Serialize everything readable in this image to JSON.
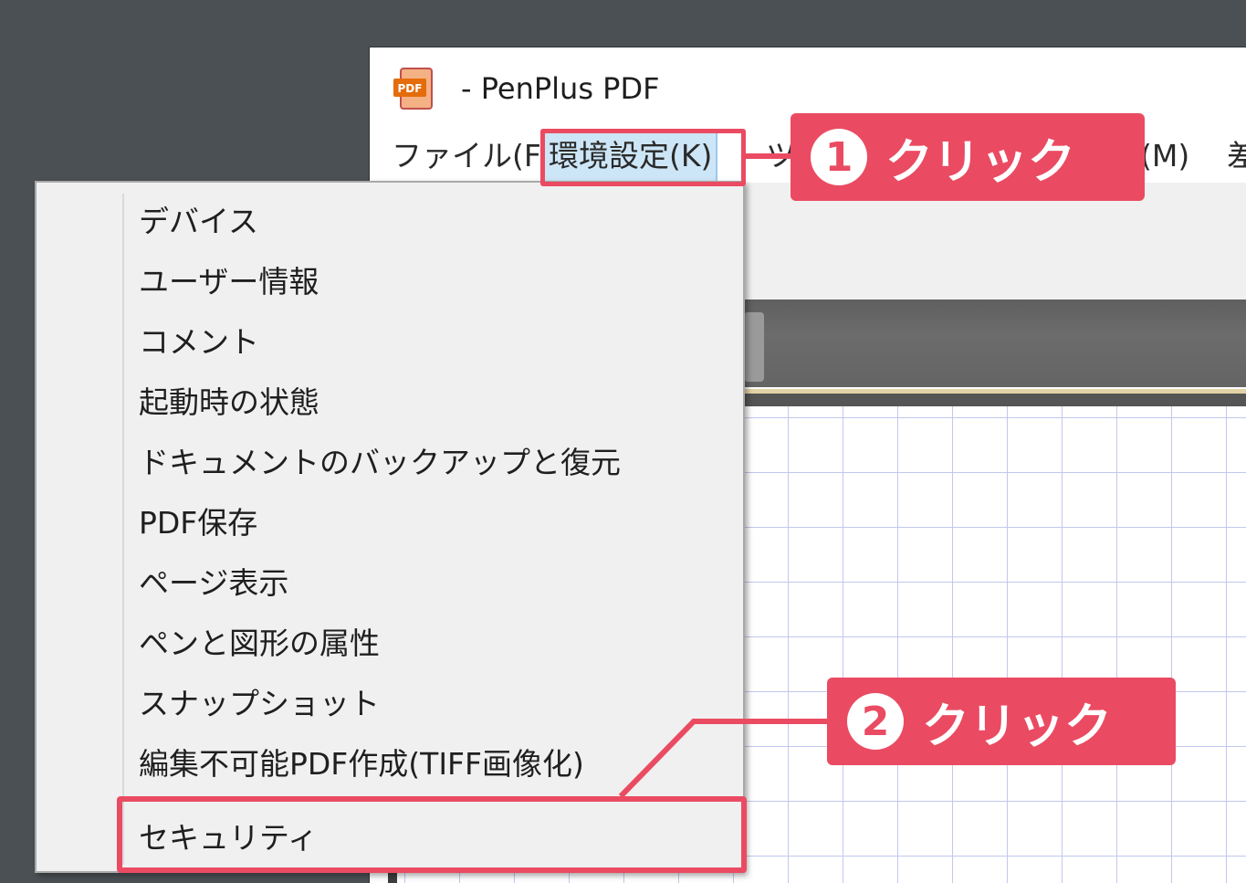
{
  "window": {
    "title": "- PenPlus PDF",
    "icon_label": "PDF"
  },
  "menu_bar": {
    "items": [
      {
        "label": "ファイル(F)"
      },
      {
        "label": "環境設定(K)"
      },
      {
        "label": "ツ"
      },
      {
        "label": "(M)"
      },
      {
        "label": "差"
      }
    ]
  },
  "dropdown": {
    "items": [
      {
        "label": "デバイス"
      },
      {
        "label": "ユーザー情報"
      },
      {
        "label": "コメント"
      },
      {
        "label": "起動時の状態"
      },
      {
        "label": "ドキュメントのバックアップと復元"
      },
      {
        "label": "PDF保存"
      },
      {
        "label": "ページ表示"
      },
      {
        "label": "ペンと図形の属性"
      },
      {
        "label": "スナップショット"
      },
      {
        "label": "編集不可能PDF作成(TIFF画像化)"
      },
      {
        "label": "セキュリティ"
      }
    ]
  },
  "callouts": {
    "step1": {
      "number": "1",
      "text": "クリック"
    },
    "step2": {
      "number": "2",
      "text": "クリック"
    }
  },
  "colors": {
    "accent": "#ea4b62",
    "menu_highlight": "#cde6f7",
    "desktop": "#4a5054"
  }
}
